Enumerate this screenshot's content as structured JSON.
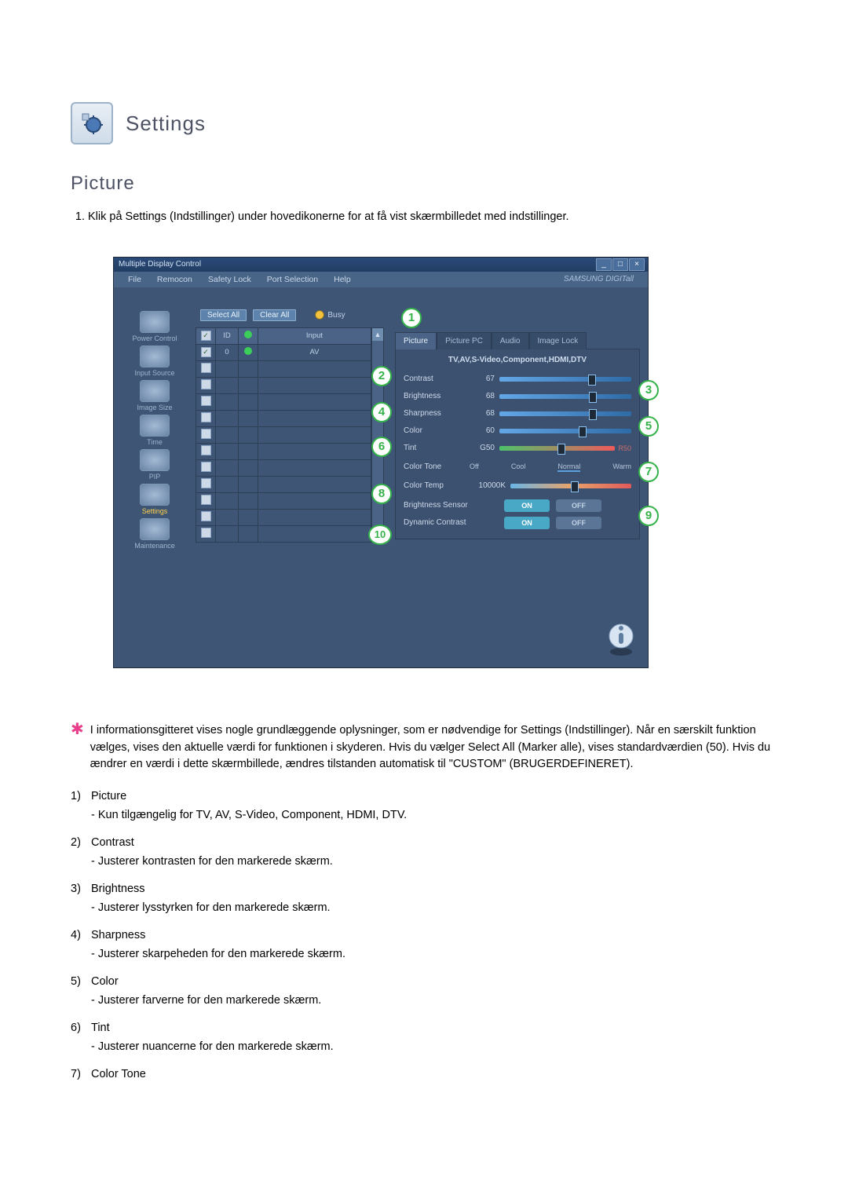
{
  "page_title": "Settings",
  "section_title": "Picture",
  "intro_item": "Klik på Settings (Indstillinger) under hovedikonerne for at få vist skærmbilledet med indstillinger.",
  "app": {
    "window_title": "Multiple Display Control",
    "menu": {
      "file": "File",
      "remocon": "Remocon",
      "safety": "Safety Lock",
      "port": "Port Selection",
      "help": "Help",
      "brand": "SAMSUNG DIGITall"
    },
    "sidebar": [
      {
        "label": "Power Control"
      },
      {
        "label": "Input Source"
      },
      {
        "label": "Image Size"
      },
      {
        "label": "Time"
      },
      {
        "label": "PIP"
      },
      {
        "label": "Settings",
        "selected": true
      },
      {
        "label": "Maintenance"
      }
    ],
    "buttons": {
      "select_all": "Select All",
      "clear_all": "Clear All",
      "busy": "Busy"
    },
    "grid": {
      "headers": {
        "chk": "",
        "id": "ID",
        "status": "",
        "input": "Input"
      },
      "first_row": {
        "id": "0",
        "input": "AV"
      },
      "blank_rows": 11
    },
    "tabs": {
      "picture": "Picture",
      "picture_pc": "Picture PC",
      "audio": "Audio",
      "image_lock": "Image Lock"
    },
    "subheader": "TV,AV,S-Video,Component,HDMI,DTV",
    "sliders": {
      "contrast": {
        "label": "Contrast",
        "value": "67",
        "pos": 67
      },
      "brightness": {
        "label": "Brightness",
        "value": "68",
        "pos": 68
      },
      "sharpness": {
        "label": "Sharpness",
        "value": "68",
        "pos": 68
      },
      "color": {
        "label": "Color",
        "value": "60",
        "pos": 60
      },
      "tint": {
        "label": "Tint",
        "value": "G50",
        "pos": 50,
        "right": "R50"
      }
    },
    "color_tone": {
      "label": "Color Tone",
      "opts": [
        "Off",
        "Cool",
        "Normal",
        "Warm"
      ]
    },
    "color_temp": {
      "label": "Color Temp",
      "value": "10000K",
      "pos": 50
    },
    "brightness_sensor": {
      "label": "Brightness Sensor",
      "on": "ON",
      "off": "OFF"
    },
    "dynamic_contrast": {
      "label": "Dynamic Contrast",
      "on": "ON",
      "off": "OFF"
    }
  },
  "callouts": {
    "c1": "1",
    "c2": "2",
    "c3": "3",
    "c4": "4",
    "c5": "5",
    "c6": "6",
    "c7": "7",
    "c8": "8",
    "c9": "9",
    "c10": "10"
  },
  "star_note": "I informationsgitteret vises nogle grundlæggende oplysninger, som er nødvendige for Settings (Indstillinger). Når en særskilt funktion vælges, vises den aktuelle værdi for funktionen i skyderen. Hvis du vælger Select All (Marker alle), vises standardværdien (50). Hvis du ændrer en værdi i dette skærmbillede, ændres tilstanden automatisk til \"CUSTOM\" (BRUGERDEFINERET).",
  "list": [
    {
      "n": "1)",
      "title": "Picture",
      "sub": "- Kun tilgængelig for TV, AV, S-Video, Component, HDMI, DTV."
    },
    {
      "n": "2)",
      "title": "Contrast",
      "sub": "- Justerer kontrasten for den markerede skærm."
    },
    {
      "n": "3)",
      "title": "Brightness",
      "sub": "- Justerer lysstyrken for den markerede skærm."
    },
    {
      "n": "4)",
      "title": "Sharpness",
      "sub": "- Justerer skarpeheden for den markerede skærm."
    },
    {
      "n": "5)",
      "title": "Color",
      "sub": "- Justerer farverne for den markerede skærm."
    },
    {
      "n": "6)",
      "title": "Tint",
      "sub": "- Justerer nuancerne for den markerede skærm."
    },
    {
      "n": "7)",
      "title": "Color Tone",
      "sub": ""
    }
  ]
}
